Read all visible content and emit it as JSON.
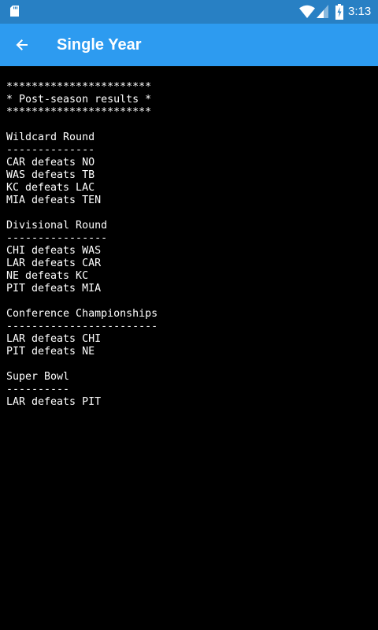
{
  "status_bar": {
    "time": "3:13",
    "icons": [
      "sd-card-icon",
      "wifi-icon",
      "signal-icon",
      "battery-charging-icon"
    ],
    "background": "#2880C4"
  },
  "toolbar": {
    "title": "Single Year",
    "back_icon": "arrow-back-icon",
    "background": "#2D9BF0"
  },
  "console": {
    "background": "#000000",
    "text_color": "#FFFFFF",
    "lines": [
      "***********************",
      "* Post-season results *",
      "***********************",
      "",
      "Wildcard Round",
      "--------------",
      "CAR defeats NO",
      "WAS defeats TB",
      "KC defeats LAC",
      "MIA defeats TEN",
      "",
      "Divisional Round",
      "----------------",
      "CHI defeats WAS",
      "LAR defeats CAR",
      "NE defeats KC",
      "PIT defeats MIA",
      "",
      "Conference Championships",
      "------------------------",
      "LAR defeats CHI",
      "PIT defeats NE",
      "",
      "Super Bowl",
      "----------",
      "LAR defeats PIT"
    ]
  }
}
